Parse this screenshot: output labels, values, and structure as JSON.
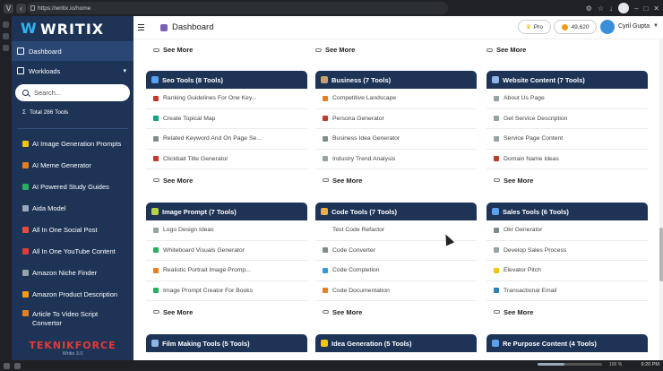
{
  "browser": {
    "url": "https://writix.io/home",
    "zoom": "100 %",
    "time": "9:20 PM"
  },
  "sidebar": {
    "logo": "WRITIX",
    "dashboard": "Dashboard",
    "workloads": "Workloads",
    "search_placeholder": "Search...",
    "total": "Total 286 Tools",
    "tools": [
      {
        "label": "AI Image Generation Prompts",
        "color": "#f1c40f"
      },
      {
        "label": "AI Meme Generator",
        "color": "#e67e22"
      },
      {
        "label": "AI Powered Study Guides",
        "color": "#27ae60"
      },
      {
        "label": "Aida Model",
        "color": "#9aa8bf"
      },
      {
        "label": "All In One Social Post",
        "color": "#e74c3c"
      },
      {
        "label": "All In One YouTube Content",
        "color": "#e53935"
      },
      {
        "label": "Amazon Niche Finder",
        "color": "#95a5a6"
      },
      {
        "label": "Amazon Product Description",
        "color": "#f39c12"
      },
      {
        "label": "Article To Video Script Convertor",
        "color": "#e67e22"
      }
    ],
    "footer_logo": "TEKNIKFORCE",
    "footer_version": "Writix 3.0"
  },
  "topbar": {
    "title": "Dashboard",
    "pro": "Pro",
    "credits": "49,620",
    "user": "Cyril Gupta"
  },
  "top_see_more": [
    "See More",
    "See More",
    "See More"
  ],
  "cards": [
    {
      "title": "Seo Tools (8 Tools)",
      "items": [
        {
          "label": "Ranking Guidelines For One Key...",
          "color": "#c0392b"
        },
        {
          "label": "Create Topical Map",
          "color": "#16a085"
        },
        {
          "label": "Related Keyword And On Page Se...",
          "color": "#7f8c8d"
        },
        {
          "label": "Clickbait Title Generator",
          "color": "#c0392b"
        }
      ],
      "see_more": "See More"
    },
    {
      "title": "Business (7 Tools)",
      "items": [
        {
          "label": "Competitive Landscape",
          "color": "#e67e22"
        },
        {
          "label": "Persona Generator",
          "color": "#c0392b"
        },
        {
          "label": "Business Idea Generator",
          "color": "#7f8c8d"
        },
        {
          "label": "Industry Trend Analysis",
          "color": "#95a5a6"
        }
      ],
      "see_more": "See More"
    },
    {
      "title": "Website Content (7 Tools)",
      "items": [
        {
          "label": "About Us Page",
          "color": "#95a5a6"
        },
        {
          "label": "Get Service Description",
          "color": "#95a5a6"
        },
        {
          "label": "Service Page Content",
          "color": "#95a5a6"
        },
        {
          "label": "Domain Name Ideas",
          "color": "#c0392b"
        }
      ],
      "see_more": "See More"
    },
    {
      "title": "Image Prompt (7 Tools)",
      "items": [
        {
          "label": "Logo Design Ideas",
          "color": "#95a5a6"
        },
        {
          "label": "Whiteboard Visuals Generator",
          "color": "#27ae60"
        },
        {
          "label": "Realistic Portrait Image Promp...",
          "color": "#e67e22"
        },
        {
          "label": "Image Prompt Creator For Books",
          "color": "#27ae60"
        }
      ],
      "see_more": "See More"
    },
    {
      "title": "Code Tools (7 Tools)",
      "items": [
        {
          "label": "Test  Code Refactor",
          "color": "#ffffff"
        },
        {
          "label": "Code Converter",
          "color": "#7f8c8d"
        },
        {
          "label": "Code Completion",
          "color": "#3498db"
        },
        {
          "label": "Code Documentation",
          "color": "#e67e22"
        }
      ],
      "see_more": "See More"
    },
    {
      "title": "Sales Tools (6 Tools)",
      "items": [
        {
          "label": "Okr Generator",
          "color": "#7f8c8d"
        },
        {
          "label": "Develop Sales Process",
          "color": "#95a5a6"
        },
        {
          "label": "Elevator Pitch",
          "color": "#f1c40f"
        },
        {
          "label": "Transactional Email",
          "color": "#2980b9"
        }
      ],
      "see_more": "See More"
    },
    {
      "title": "Film Making Tools (5 Tools)",
      "items": [],
      "see_more": ""
    },
    {
      "title": "Idea Generation (5 Tools)",
      "items": [],
      "see_more": ""
    },
    {
      "title": "Re Purpose Content (4 Tools)",
      "items": [],
      "see_more": ""
    }
  ]
}
